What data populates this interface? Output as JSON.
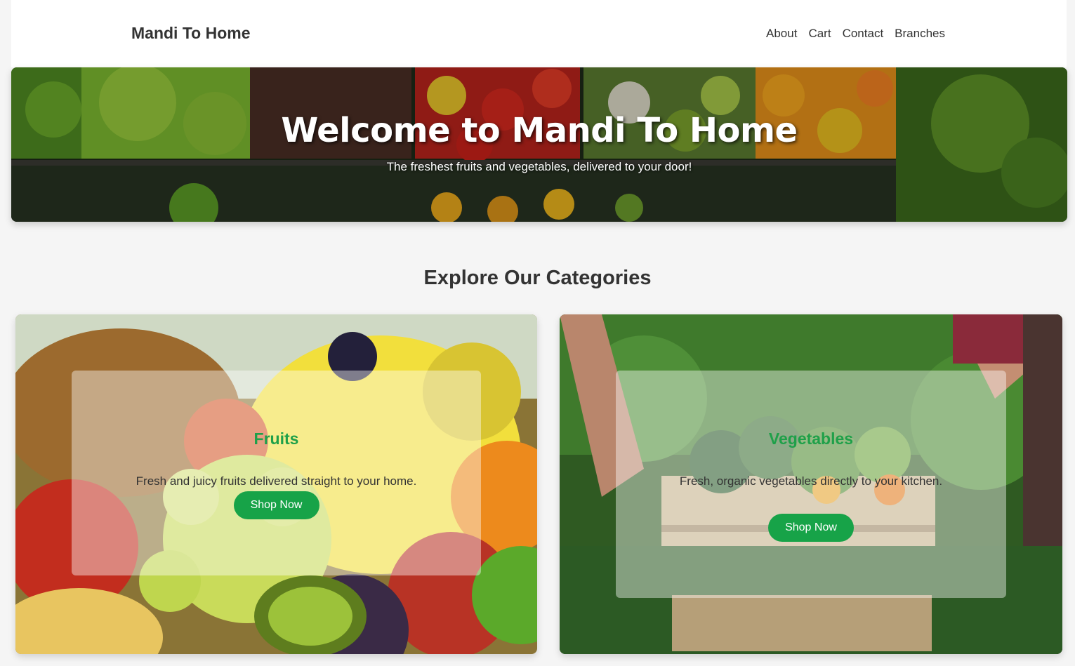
{
  "nav": {
    "brand": "Mandi To Home",
    "links": [
      "About",
      "Cart",
      "Contact",
      "Branches"
    ]
  },
  "hero": {
    "title": "Welcome to Mandi To Home",
    "subtitle": "The freshest fruits and vegetables, delivered to your door!"
  },
  "categories": {
    "heading": "Explore Our Categories",
    "items": [
      {
        "title": "Fruits",
        "description": "Fresh and juicy fruits delivered straight to your home.",
        "button": "Shop Now"
      },
      {
        "title": "Vegetables",
        "description": "Fresh, organic vegetables directly to your kitchen.",
        "button": "Shop Now"
      }
    ]
  },
  "colors": {
    "accent_green": "#17a348",
    "title_green": "#1fa049",
    "text": "#333333",
    "background": "#f5f5f5"
  }
}
